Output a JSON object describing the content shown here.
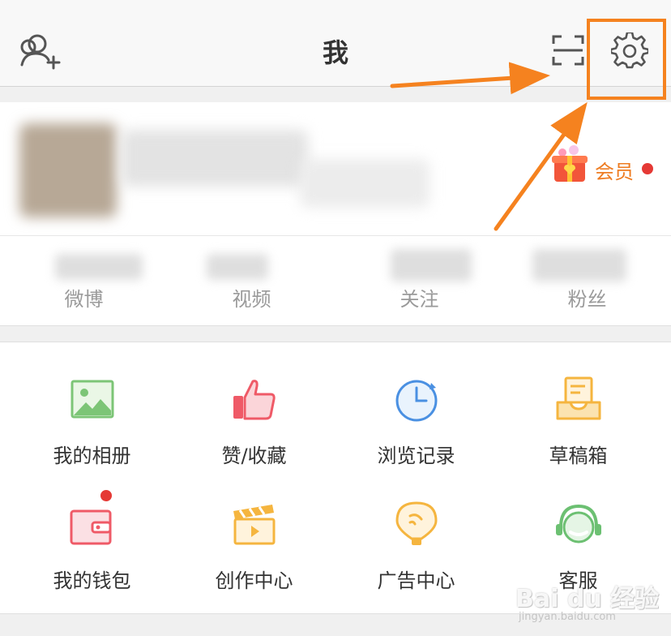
{
  "header": {
    "title": "我",
    "add_friend_icon": "add-user-icon",
    "scan_icon": "scan-icon",
    "settings_icon": "gear-icon"
  },
  "profile": {
    "vip_label": "会员",
    "vip_icon": "gift-box-icon"
  },
  "stats": [
    {
      "label": "微博"
    },
    {
      "label": "视频"
    },
    {
      "label": "关注"
    },
    {
      "label": "粉丝"
    }
  ],
  "grid": [
    {
      "label": "我的相册",
      "icon": "photo-album-icon"
    },
    {
      "label": "赞/收藏",
      "icon": "thumbs-up-icon"
    },
    {
      "label": "浏览记录",
      "icon": "history-clock-icon"
    },
    {
      "label": "草稿箱",
      "icon": "draft-box-icon"
    },
    {
      "label": "我的钱包",
      "icon": "wallet-icon"
    },
    {
      "label": "创作中心",
      "icon": "creator-clapperboard-icon"
    },
    {
      "label": "广告中心",
      "icon": "ad-balloon-icon"
    },
    {
      "label": "客服",
      "icon": "customer-service-headset-icon"
    }
  ],
  "watermark": {
    "brand": "Bai du 经验",
    "url": "jingyan.baidu.com"
  },
  "colors": {
    "accent": "#ee7c22",
    "annotation": "#f5821f",
    "badge": "#e53935"
  }
}
